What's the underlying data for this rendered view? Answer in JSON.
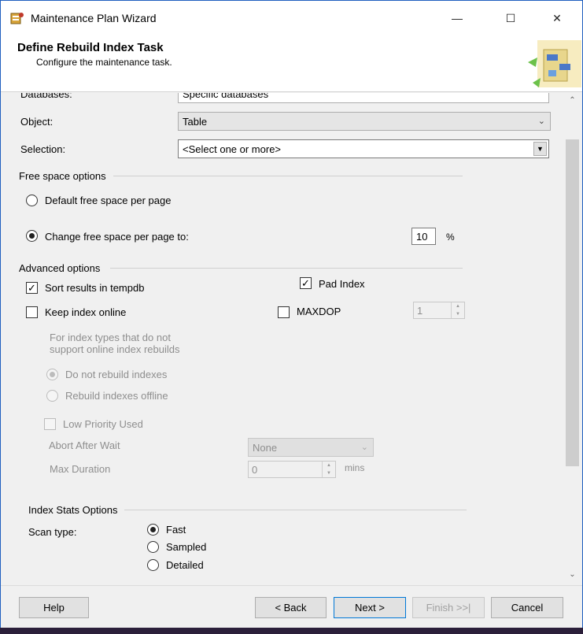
{
  "window": {
    "title": "Maintenance Plan Wizard",
    "minimize_glyph": "—",
    "maximize_glyph": "☐",
    "close_glyph": "✕"
  },
  "header": {
    "title": "Define Rebuild Index Task",
    "subtitle": "Configure the maintenance task."
  },
  "form": {
    "databases_label": "Databases:",
    "databases_value": "Specific databases",
    "object_label": "Object:",
    "object_value": "Table",
    "selection_label": "Selection:",
    "selection_value": "<Select one or more>"
  },
  "free_space": {
    "group_label": "Free space options",
    "default_label": "Default free space per page",
    "change_label": "Change free space per page to:",
    "value": "10",
    "unit": "%",
    "selected": "change"
  },
  "advanced": {
    "group_label": "Advanced options",
    "sort_tempdb_label": "Sort results in tempdb",
    "sort_tempdb_checked": true,
    "pad_index_label": "Pad Index",
    "pad_index_checked": true,
    "keep_online_label": "Keep index online",
    "keep_online_checked": false,
    "maxdop_label": "MAXDOP",
    "maxdop_checked": false,
    "maxdop_value": "1",
    "online_note": "For index types that do not support online index rebuilds",
    "do_not_rebuild_label": "Do not rebuild indexes",
    "rebuild_offline_label": "Rebuild indexes offline",
    "low_priority_label": "Low Priority Used",
    "abort_after_wait_label": "Abort After Wait",
    "abort_after_wait_value": "None",
    "max_duration_label": "Max Duration",
    "max_duration_value": "0",
    "max_duration_unit": "mins"
  },
  "index_stats": {
    "group_label": "Index Stats Options",
    "scan_type_label": "Scan type:",
    "options": [
      "Fast",
      "Sampled",
      "Detailed"
    ],
    "selected": "Fast"
  },
  "footer": {
    "help": "Help",
    "back": "< Back",
    "next": "Next >",
    "finish": "Finish >>|",
    "cancel": "Cancel"
  },
  "colors": {
    "accent": "#0078d7",
    "window_bg": "#f0f0f0",
    "disabled_text": "#8e8e8e"
  }
}
